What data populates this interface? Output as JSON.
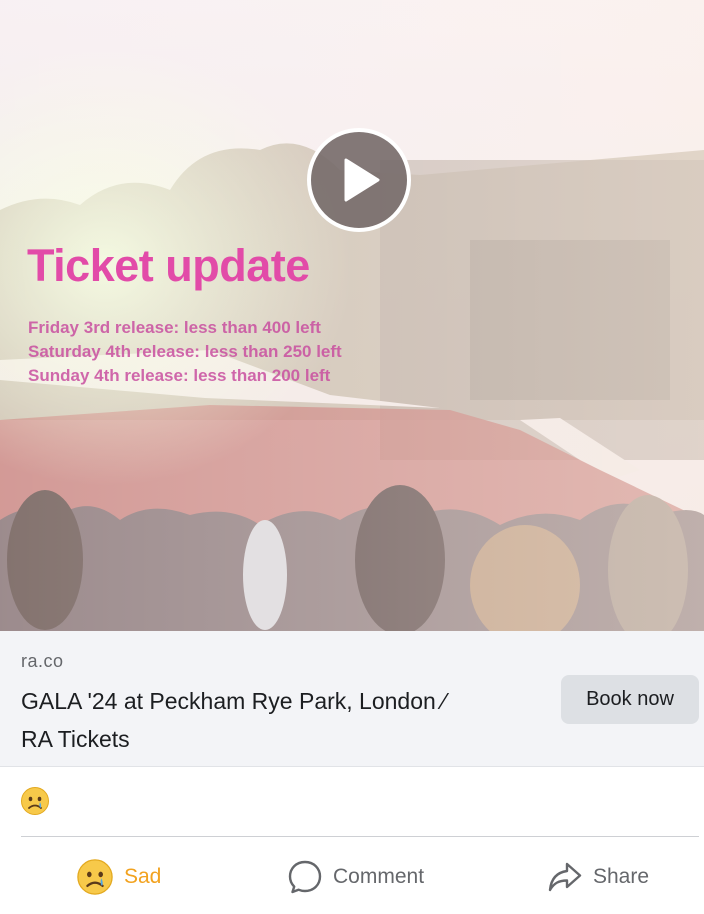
{
  "video": {
    "overlay_title": "Ticket update",
    "release_lines": [
      "Friday 3rd release: less than 400 left",
      "Saturday 4th release: less than 250 left",
      "Sunday 4th release: less than 200 left"
    ],
    "play_icon": "play-icon"
  },
  "link_preview": {
    "domain": "ra.co",
    "title_line1": "GALA '24 at Peckham Rye Park, London ⁄",
    "title_line2": "RA Tickets",
    "cta_label": "Book now"
  },
  "reactions": {
    "summary_icon": "sad-emoji-icon"
  },
  "actions": {
    "sad_label": "Sad",
    "comment_label": "Comment",
    "share_label": "Share"
  },
  "colors": {
    "overlay_pink": "#e24ba8",
    "sad_active": "#f2a21f",
    "muted_text": "#65676b",
    "preview_bg": "#f3f4f7"
  }
}
